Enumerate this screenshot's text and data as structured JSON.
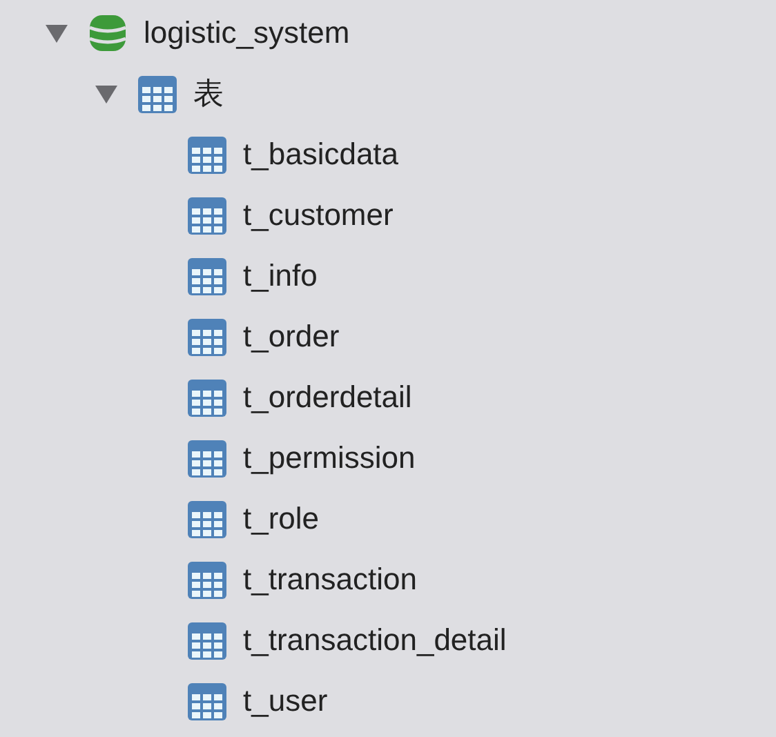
{
  "tree": [
    {
      "label": "logistic_system",
      "kind": "database",
      "expanded": true,
      "children": [
        {
          "label": "表",
          "kind": "folder",
          "expanded": true,
          "children": [
            {
              "label": "t_basicdata",
              "kind": "table"
            },
            {
              "label": "t_customer",
              "kind": "table"
            },
            {
              "label": "t_info",
              "kind": "table"
            },
            {
              "label": "t_order",
              "kind": "table"
            },
            {
              "label": "t_orderdetail",
              "kind": "table"
            },
            {
              "label": "t_permission",
              "kind": "table"
            },
            {
              "label": "t_role",
              "kind": "table"
            },
            {
              "label": "t_transaction",
              "kind": "table"
            },
            {
              "label": "t_transaction_detail",
              "kind": "table"
            },
            {
              "label": "t_user",
              "kind": "table"
            }
          ]
        }
      ]
    }
  ]
}
